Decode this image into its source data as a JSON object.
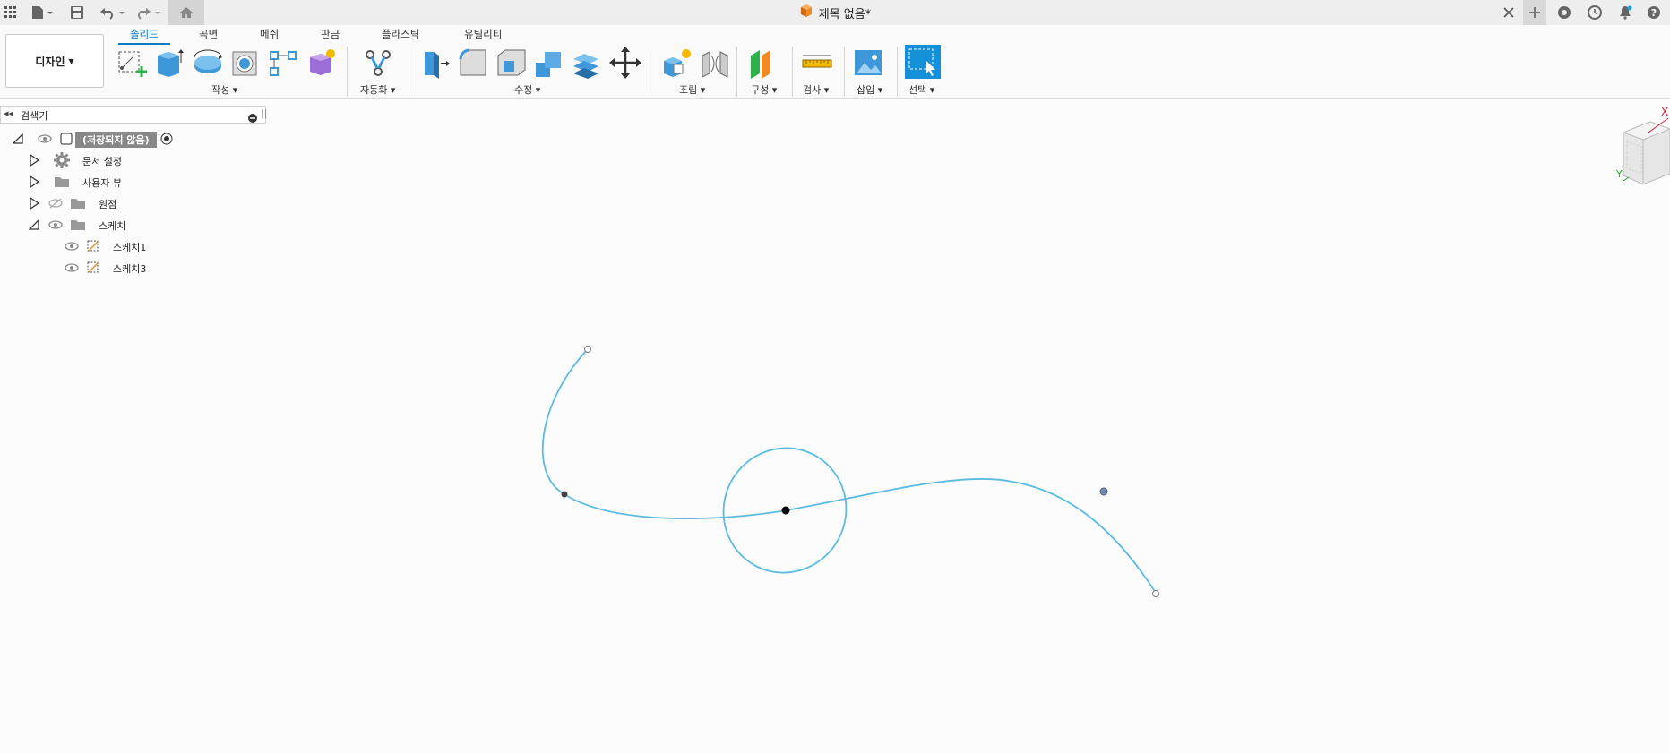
{
  "app": {
    "document_title": "제목 없음*",
    "design_button_label": "디자인",
    "tabs": [
      {
        "label": "솔리드",
        "active": true
      },
      {
        "label": "곡면"
      },
      {
        "label": "메쉬"
      },
      {
        "label": "판금"
      },
      {
        "label": "플라스틱"
      },
      {
        "label": "유틸리티"
      }
    ],
    "groups": {
      "create": "작성",
      "automate": "자동화",
      "modify": "수정",
      "assemble": "조립",
      "construct": "구성",
      "inspect": "검사",
      "insert": "삽입",
      "select": "선택"
    }
  },
  "browser": {
    "title": "검색기",
    "root_label": "(저장되지 않음)",
    "items": [
      {
        "label": "문서 설정"
      },
      {
        "label": "사용자 뷰"
      },
      {
        "label": "원점"
      },
      {
        "label": "스케치"
      },
      {
        "label": "스케치1"
      },
      {
        "label": "스케치3"
      }
    ]
  },
  "viewcube": {
    "x_label": "X",
    "y_label": "Y"
  },
  "colors": {
    "accent": "#0a7bc4",
    "sketch_curve": "#5bbbe0",
    "toolbar_blue": "#3d97d9"
  }
}
